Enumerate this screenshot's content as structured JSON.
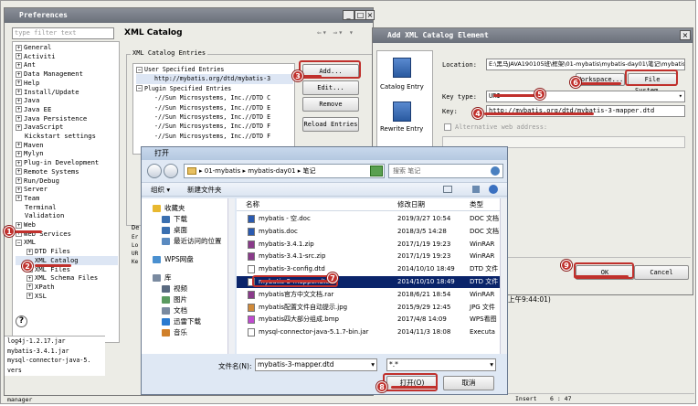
{
  "preferences": {
    "title": "Preferences",
    "filter_placeholder": "type filter text",
    "tree": [
      "General",
      "Activiti",
      "Ant",
      "Data Management",
      "Help",
      "Install/Update",
      "Java",
      "Java EE",
      "Java Persistence",
      "JavaScript",
      "Kickstart settings",
      "Maven",
      "Mylyn",
      "Plug-in Development",
      "Remote Systems",
      "Run/Debug",
      "Server",
      "Team",
      "Terminal",
      "Validation",
      "Web",
      "Web Services",
      "XML"
    ],
    "xml_children": [
      "DTD Files",
      "XML Catalog",
      "XML Files",
      "XML Schema Files",
      "XPath",
      "XSL"
    ],
    "bottom_list": [
      "log4j-1.2.17.jar",
      "mybatis-3.4.1.jar",
      "mysql-connector-java-5.",
      "vers"
    ],
    "bottom_label": "manager",
    "help_icon": "?"
  },
  "xml_catalog": {
    "title": "XML Catalog",
    "entries_label": "XML Catalog Entries",
    "entries": [
      "User Specified Entries",
      "http://mybatis.org/dtd/mybatis-3",
      "Plugin Specified Entries",
      "-//Sun Microsystems, Inc.//DTD C",
      "-//Sun Microsystems, Inc.//DTD E",
      "-//Sun Microsystems, Inc.//DTD E",
      "-//Sun Microsystems, Inc.//DTD F",
      "-//Sun Microsystems, Inc.//DTD F"
    ],
    "buttons": [
      "Add...",
      "Edit...",
      "Remove",
      "Reload Entries"
    ],
    "details_prefix": "De",
    "side_letters": [
      "Er",
      "Lo",
      "UR",
      "Ke"
    ],
    "nav": [
      "⇐",
      "▾",
      "⇒",
      "▾",
      "▾"
    ]
  },
  "add_dialog": {
    "title": "Add XML Catalog Element",
    "side_items": [
      "Catalog Entry",
      "Rewrite Entry"
    ],
    "location_label": "Location:",
    "location_value": "E:\\黑马JAVA190105班\\框架\\01-mybatis\\mybatis-day01\\笔记\\mybatis",
    "workspace_button": "Workspace...",
    "filesystem_button": "File System...",
    "keytype_label": "Key type:",
    "keytype_value": "URI",
    "key_label": "Key:",
    "key_value": "http://mybatis.org/dtd/mybatis-3-mapper.dtd",
    "alt_label": "Alternative web address:",
    "ok": "OK",
    "cancel": "Cancel",
    "status": "上午9:44:01)",
    "insert": "Insert",
    "pos": "6 : 47"
  },
  "open_dialog": {
    "title": "打开",
    "breadcrumb": [
      "01-mybatis",
      "mybatis-day01",
      "笔记"
    ],
    "search_placeholder": "搜索 笔记",
    "organize": "组织 ▾",
    "new_folder": "新建文件夹",
    "nav": [
      {
        "label": "收藏夹",
        "color": "#e8b830"
      },
      {
        "label": "下载",
        "color": "#3a6fb0"
      },
      {
        "label": "桌面",
        "color": "#3a6fb0"
      },
      {
        "label": "最近访问的位置",
        "color": "#5a8ac0"
      },
      {
        "label": "WPS网盘",
        "color": "#4a90d0"
      },
      {
        "label": "库",
        "color": "#7a8aa0"
      },
      {
        "label": "视频",
        "color": "#5a6a80"
      },
      {
        "label": "图片",
        "color": "#5a9a60"
      },
      {
        "label": "文档",
        "color": "#7a8aa0"
      },
      {
        "label": "迅雷下载",
        "color": "#2a7ad0"
      },
      {
        "label": "音乐",
        "color": "#d0802a"
      }
    ],
    "columns": [
      "名称",
      "修改日期",
      "类型"
    ],
    "files": [
      {
        "name": "mybatis - 空.doc",
        "date": "2019/3/27 10:54",
        "type": "DOC 文档",
        "color": "#2a5ab0"
      },
      {
        "name": "mybatis.doc",
        "date": "2018/3/5 14:28",
        "type": "DOC 文档",
        "color": "#2a5ab0"
      },
      {
        "name": "mybatis-3.4.1.zip",
        "date": "2017/1/19 19:23",
        "type": "WinRAR",
        "color": "#8a3a8a"
      },
      {
        "name": "mybatis-3.4.1-src.zip",
        "date": "2017/1/19 19:23",
        "type": "WinRAR",
        "color": "#8a3a8a"
      },
      {
        "name": "mybatis-3-config.dtd",
        "date": "2014/10/10 18:49",
        "type": "DTD 文件",
        "color": "#ffffff"
      },
      {
        "name": "mybatis-3-mapper.dtd",
        "date": "2014/10/10 18:49",
        "type": "DTD 文件",
        "color": "#ffffff"
      },
      {
        "name": "mybatis官方中文文档.rar",
        "date": "2018/6/21 18:54",
        "type": "WinRAR",
        "color": "#8a3a8a"
      },
      {
        "name": "mybatis配置文件自动提示.jpg",
        "date": "2015/9/29 12:45",
        "type": "JPG 文件",
        "color": "#d08a3a"
      },
      {
        "name": "mybatis四大部分组成.bmp",
        "date": "2017/4/8 14:09",
        "type": "WPS看图",
        "color": "#c04ad0"
      },
      {
        "name": "mysql-connector-java-5.1.7-bin.jar",
        "date": "2014/11/3 18:08",
        "type": "Executa",
        "color": "#ffffff"
      }
    ],
    "selected_index": 5,
    "filename_label": "文件名(N):",
    "filename_value": "mybatis-3-mapper.dtd",
    "filter_value": "*.*",
    "open_button": "打开(O)",
    "cancel_button": "取消"
  },
  "annotations": [
    "1",
    "2",
    "3",
    "4",
    "5",
    "6",
    "7",
    "8",
    "9"
  ],
  "accent_color": "#c0302c"
}
